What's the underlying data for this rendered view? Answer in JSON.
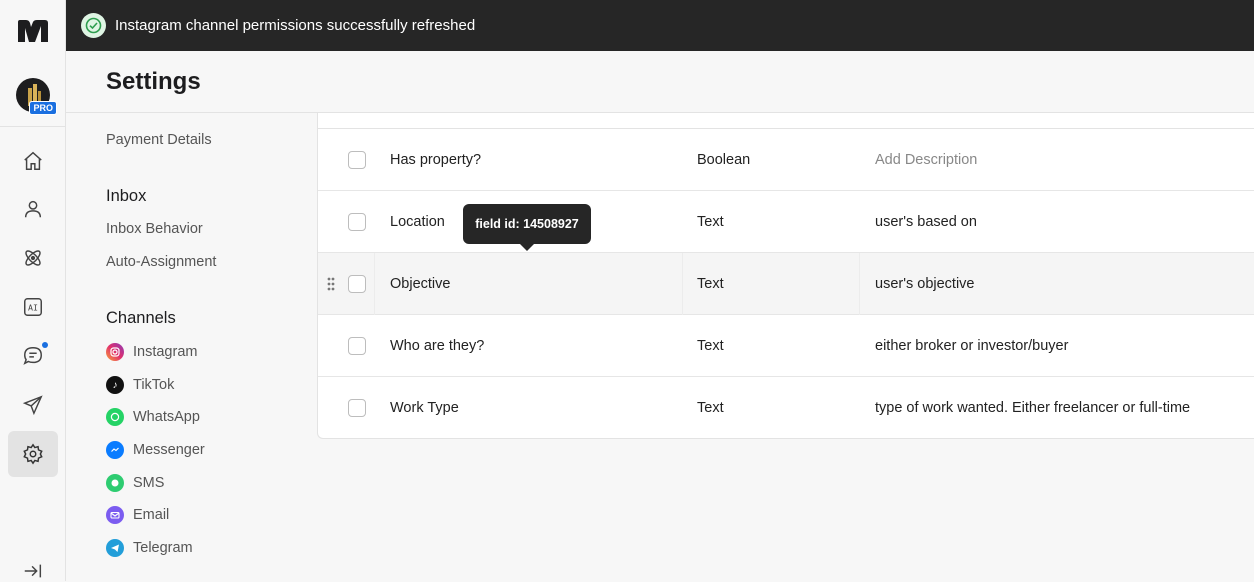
{
  "toast": {
    "message": "Instagram channel permissions successfully refreshed",
    "icon": "check-circle-icon"
  },
  "header": {
    "title": "Settings"
  },
  "rail": {
    "avatar_badge": "PRO",
    "items": [
      {
        "icon": "home-icon"
      },
      {
        "icon": "contacts-icon"
      },
      {
        "icon": "workflows-icon"
      },
      {
        "icon": "ai-icon"
      },
      {
        "icon": "inbox-chat-icon",
        "has_dot": true
      },
      {
        "icon": "broadcast-send-icon"
      },
      {
        "icon": "settings-gear-icon",
        "active": true
      }
    ]
  },
  "side": {
    "payment_details": "Payment Details",
    "inbox_heading": "Inbox",
    "inbox_behavior": "Inbox Behavior",
    "auto_assignment": "Auto-Assignment",
    "channels_heading": "Channels",
    "channels": [
      {
        "label": "Instagram",
        "color": "#e1306c"
      },
      {
        "label": "TikTok",
        "color": "#111111"
      },
      {
        "label": "WhatsApp",
        "color": "#25d366"
      },
      {
        "label": "Messenger",
        "color": "#0a7cff"
      },
      {
        "label": "SMS",
        "color": "#2ecc71"
      },
      {
        "label": "Email",
        "color": "#7b5cf0"
      },
      {
        "label": "Telegram",
        "color": "#229ed9"
      }
    ]
  },
  "table": {
    "rows": [
      {
        "name": "Has property?",
        "type": "Boolean",
        "description": "Add Description",
        "placeholder": true
      },
      {
        "name": "Location",
        "type": "Text",
        "description": "user's based on"
      },
      {
        "name": "Objective",
        "type": "Text",
        "description": "user's objective"
      },
      {
        "name": "Who are they?",
        "type": "Text",
        "description": "either broker or investor/buyer"
      },
      {
        "name": "Work Type",
        "type": "Text",
        "description": "type of work wanted. Either freelancer or full-time"
      }
    ]
  },
  "tooltip": {
    "text": "field id: 14508927"
  }
}
